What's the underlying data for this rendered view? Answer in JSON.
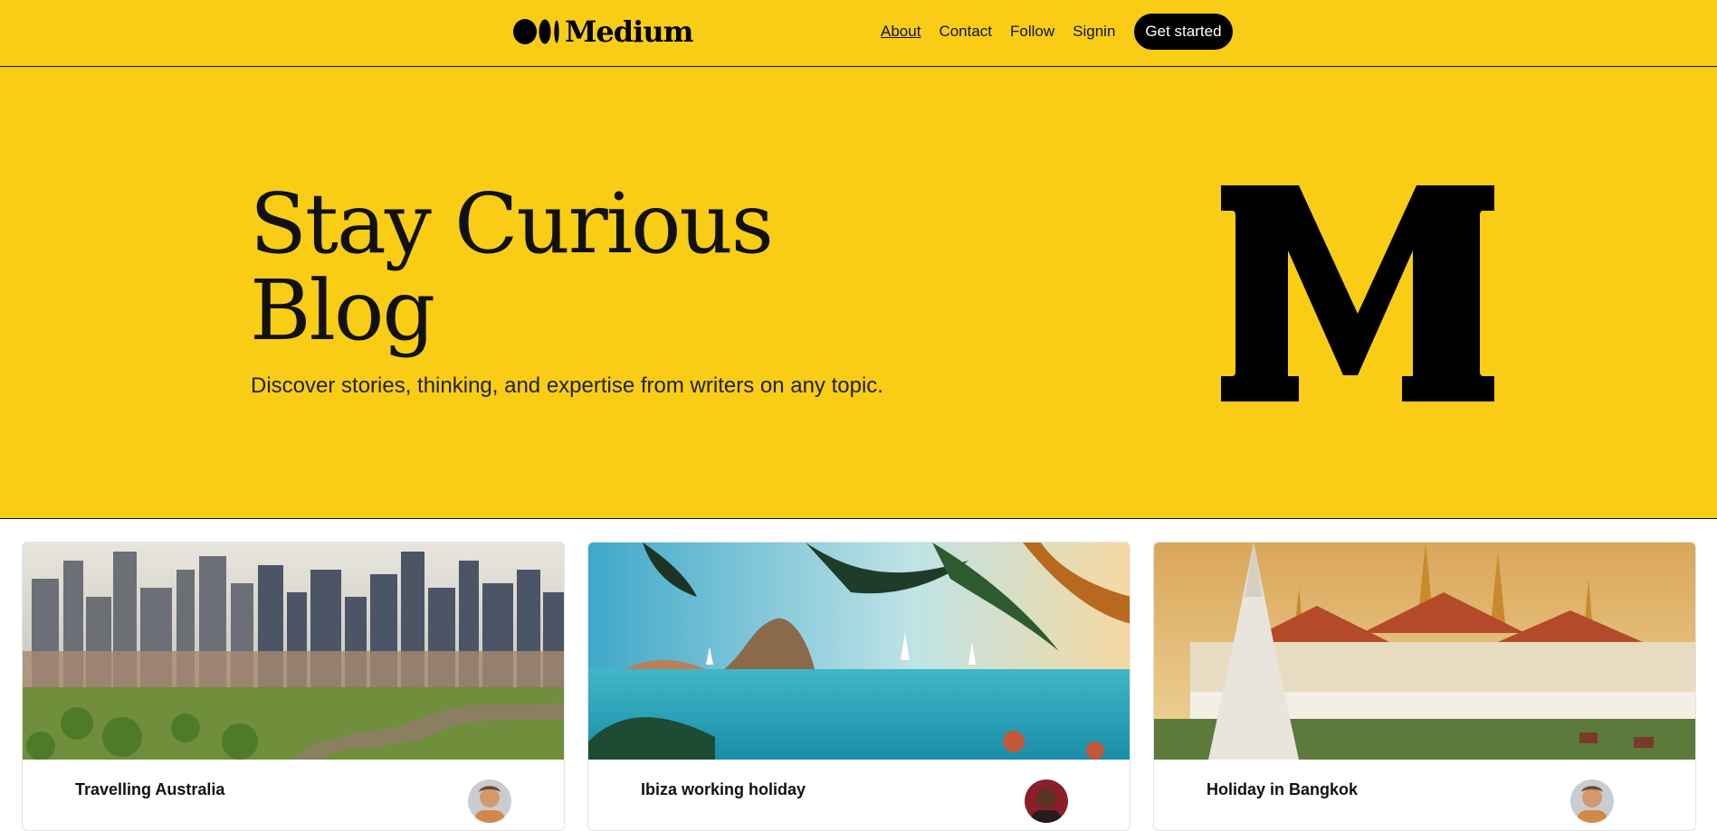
{
  "header": {
    "brand_name": "Medium",
    "nav": [
      {
        "label": "About"
      },
      {
        "label": "Contact"
      },
      {
        "label": "Follow"
      },
      {
        "label": "Signin"
      }
    ],
    "cta_label": "Get started"
  },
  "hero": {
    "title_line1": "Stay Curious",
    "title_line2": "Blog",
    "subtitle": "Discover stories, thinking, and expertise from writers on any topic.",
    "logo_icon": "medium-m-icon"
  },
  "cards": [
    {
      "title": "Travelling Australia",
      "image": "city-skyline-photo"
    },
    {
      "title": "Ibiza working holiday",
      "image": "beach-palms-photo"
    },
    {
      "title": "Holiday in Bangkok",
      "image": "temple-photo"
    }
  ],
  "colors": {
    "accent": "#f9cd15",
    "text": "#111111",
    "button_bg": "#000000",
    "button_text": "#ffffff"
  }
}
